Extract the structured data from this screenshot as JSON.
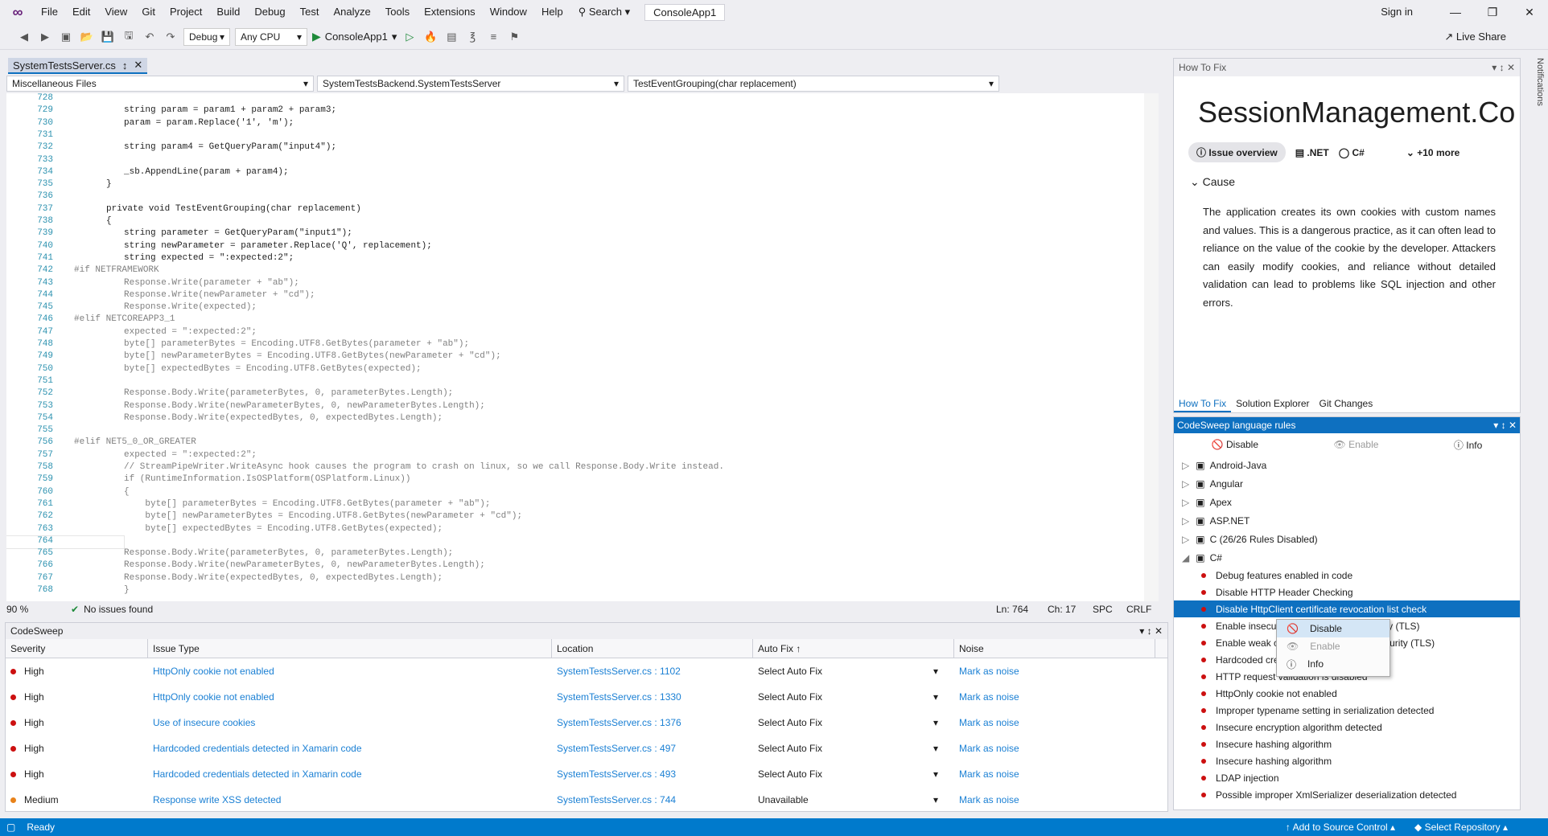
{
  "menu": {
    "items": [
      "File",
      "Edit",
      "View",
      "Git",
      "Project",
      "Build",
      "Debug",
      "Test",
      "Analyze",
      "Tools",
      "Extensions",
      "Window",
      "Help"
    ],
    "search": "Search",
    "solution": "ConsoleApp1",
    "signin": "Sign in"
  },
  "toolbar": {
    "config": "Debug",
    "platform": "Any CPU",
    "run_target": "ConsoleApp1",
    "live_share": "Live Share"
  },
  "editor": {
    "tab_name": "SystemTestsServer.cs",
    "nav": [
      "Miscellaneous Files",
      "SystemTestsBackend.SystemTestsServer",
      "TestEventGrouping(char replacement)"
    ],
    "zoom": "90 %",
    "issues": "No issues found",
    "position": "Ln: 764",
    "column": "Ch: 17",
    "spacing": "SPC",
    "eol": "CRLF",
    "lines": [
      {
        "n": "728",
        "t": "",
        "c": ""
      },
      {
        "n": "729",
        "t": "string param = param1 + param2 + param3;",
        "c": "k1"
      },
      {
        "n": "730",
        "t": "param = param.Replace('1', 'm');",
        "c": ""
      },
      {
        "n": "731",
        "t": "",
        "c": ""
      },
      {
        "n": "732",
        "t": "string param4 = GetQueryParam(\"input4\");",
        "c": "k1"
      },
      {
        "n": "733",
        "t": "",
        "c": ""
      },
      {
        "n": "734",
        "t": "_sb.AppendLine(param + param4);",
        "c": ""
      },
      {
        "n": "735",
        "t": "}",
        "c": "b"
      },
      {
        "n": "736",
        "t": "",
        "c": ""
      },
      {
        "n": "737",
        "t": "private void TestEventGrouping(char replacement)",
        "c": "kd"
      },
      {
        "n": "738",
        "t": "{",
        "c": "b"
      },
      {
        "n": "739",
        "t": "string parameter = GetQueryParam(\"input1\");",
        "c": "k1"
      },
      {
        "n": "740",
        "t": "string newParameter = parameter.Replace('Q', replacement);",
        "c": "k1"
      },
      {
        "n": "741",
        "t": "string expected = \":expected:2\";",
        "c": "k1"
      },
      {
        "n": "742",
        "t": "#if NETFRAMEWORK",
        "c": "pp"
      },
      {
        "n": "743",
        "t": "Response.Write(parameter + \"ab\");",
        "c": "dim"
      },
      {
        "n": "744",
        "t": "Response.Write(newParameter + \"cd\");",
        "c": "dim"
      },
      {
        "n": "745",
        "t": "Response.Write(expected);",
        "c": "dim"
      },
      {
        "n": "746",
        "t": "#elif NETCOREAPP3_1",
        "c": "pp"
      },
      {
        "n": "747",
        "t": "expected = \":expected:2\";",
        "c": "dim"
      },
      {
        "n": "748",
        "t": "byte[] parameterBytes = Encoding.UTF8.GetBytes(parameter + \"ab\");",
        "c": "dim"
      },
      {
        "n": "749",
        "t": "byte[] newParameterBytes = Encoding.UTF8.GetBytes(newParameter + \"cd\");",
        "c": "dim"
      },
      {
        "n": "750",
        "t": "byte[] expectedBytes = Encoding.UTF8.GetBytes(expected);",
        "c": "dim"
      },
      {
        "n": "751",
        "t": "",
        "c": ""
      },
      {
        "n": "752",
        "t": "Response.Body.Write(parameterBytes, 0, parameterBytes.Length);",
        "c": "dim"
      },
      {
        "n": "753",
        "t": "Response.Body.Write(newParameterBytes, 0, newParameterBytes.Length);",
        "c": "dim"
      },
      {
        "n": "754",
        "t": "Response.Body.Write(expectedBytes, 0, expectedBytes.Length);",
        "c": "dim"
      },
      {
        "n": "755",
        "t": "",
        "c": ""
      },
      {
        "n": "756",
        "t": "#elif NET5_0_OR_GREATER",
        "c": "pp"
      },
      {
        "n": "757",
        "t": "expected = \":expected:2\";",
        "c": "dim"
      },
      {
        "n": "758",
        "t": "// StreamPipeWriter.WriteAsync hook causes the program to crash on linux, so we call Response.Body.Write instead.",
        "c": "dim"
      },
      {
        "n": "759",
        "t": "if (RuntimeInformation.IsOSPlatform(OSPlatform.Linux))",
        "c": "dim"
      },
      {
        "n": "760",
        "t": "{",
        "c": "dim"
      },
      {
        "n": "761",
        "t": "    byte[] parameterBytes = Encoding.UTF8.GetBytes(parameter + \"ab\");",
        "c": "dim"
      },
      {
        "n": "762",
        "t": "    byte[] newParameterBytes = Encoding.UTF8.GetBytes(newParameter + \"cd\");",
        "c": "dim"
      },
      {
        "n": "763",
        "t": "    byte[] expectedBytes = Encoding.UTF8.GetBytes(expected);",
        "c": "dim"
      },
      {
        "n": "764",
        "t": "",
        "c": ""
      },
      {
        "n": "765",
        "t": "Response.Body.Write(parameterBytes, 0, parameterBytes.Length);",
        "c": "dim"
      },
      {
        "n": "766",
        "t": "Response.Body.Write(newParameterBytes, 0, newParameterBytes.Length);",
        "c": "dim"
      },
      {
        "n": "767",
        "t": "Response.Body.Write(expectedBytes, 0, expectedBytes.Length);",
        "c": "dim"
      },
      {
        "n": "768",
        "t": "}",
        "c": "dim"
      }
    ]
  },
  "codesweep": {
    "title": "CodeSweep",
    "columns": [
      "Severity",
      "Issue Type",
      "Location",
      "Auto Fix ↑",
      "Noise"
    ],
    "rows": [
      {
        "severity": "High",
        "issue": "HttpOnly cookie not enabled",
        "location": "SystemTestsServer.cs : 1102",
        "autofix": "Select Auto Fix",
        "noise": "Mark as noise",
        "color": "#cc1010"
      },
      {
        "severity": "High",
        "issue": "HttpOnly cookie not enabled",
        "location": "SystemTestsServer.cs : 1330",
        "autofix": "Select Auto Fix",
        "noise": "Mark as noise",
        "color": "#cc1010"
      },
      {
        "severity": "High",
        "issue": "Use of insecure cookies",
        "location": "SystemTestsServer.cs : 1376",
        "autofix": "Select Auto Fix",
        "noise": "Mark as noise",
        "color": "#cc1010"
      },
      {
        "severity": "High",
        "issue": "Hardcoded credentials detected in Xamarin code",
        "location": "SystemTestsServer.cs : 497",
        "autofix": "Select Auto Fix",
        "noise": "Mark as noise",
        "color": "#cc1010"
      },
      {
        "severity": "High",
        "issue": "Hardcoded credentials detected in Xamarin code",
        "location": "SystemTestsServer.cs : 493",
        "autofix": "Select Auto Fix",
        "noise": "Mark as noise",
        "color": "#cc1010"
      },
      {
        "severity": "Medium",
        "issue": "Response write XSS detected",
        "location": "SystemTestsServer.cs : 744",
        "autofix": "Unavailable",
        "noise": "Mark as noise",
        "color": "#e8821a"
      }
    ]
  },
  "howtofix": {
    "header": "How To Fix",
    "title": "SessionManagement.Co",
    "tags": [
      "Issue overview",
      ".NET",
      "C#",
      "+10 more"
    ],
    "cause": "Cause",
    "text": "The application creates its own cookies with custom names and values. This is a dangerous practice, as it can often lead to reliance on the value of the cookie by the developer. Attackers can easily modify cookies, and reliance without detailed validation can lead to problems like SQL injection and other errors.",
    "tabs": [
      "How To Fix",
      "Solution Explorer",
      "Git Changes"
    ]
  },
  "rules": {
    "header": "CodeSweep language rules",
    "actions": [
      "Disable",
      "Enable",
      "Info"
    ],
    "groups": [
      "Android-Java",
      "Angular",
      "Apex",
      "ASP.NET",
      "C (26/26 Rules Disabled)",
      "C#"
    ],
    "children": [
      "Debug features enabled in code",
      "Disable HTTP Header Checking",
      "Disable HttpClient certificate revocation list check",
      "Enable insecure Transport Layer Security (TLS)",
      "Enable weak cipher Transport Layer Security (TLS)",
      "Hardcoded credentials",
      "HTTP request validation is disabled",
      "HttpOnly cookie not enabled",
      "Improper typename setting in serialization detected",
      "Insecure encryption algorithm detected",
      "Insecure hashing algorithm",
      "Insecure hashing algorithm",
      "LDAP injection",
      "Possible improper XmlSerializer deserialization detected"
    ],
    "context_menu": [
      "Disable",
      "Enable",
      "Info"
    ]
  },
  "notifications": "Notifications",
  "statusbar": {
    "ready": "Ready",
    "source_control": "Add to Source Control",
    "repository": "Select Repository"
  }
}
